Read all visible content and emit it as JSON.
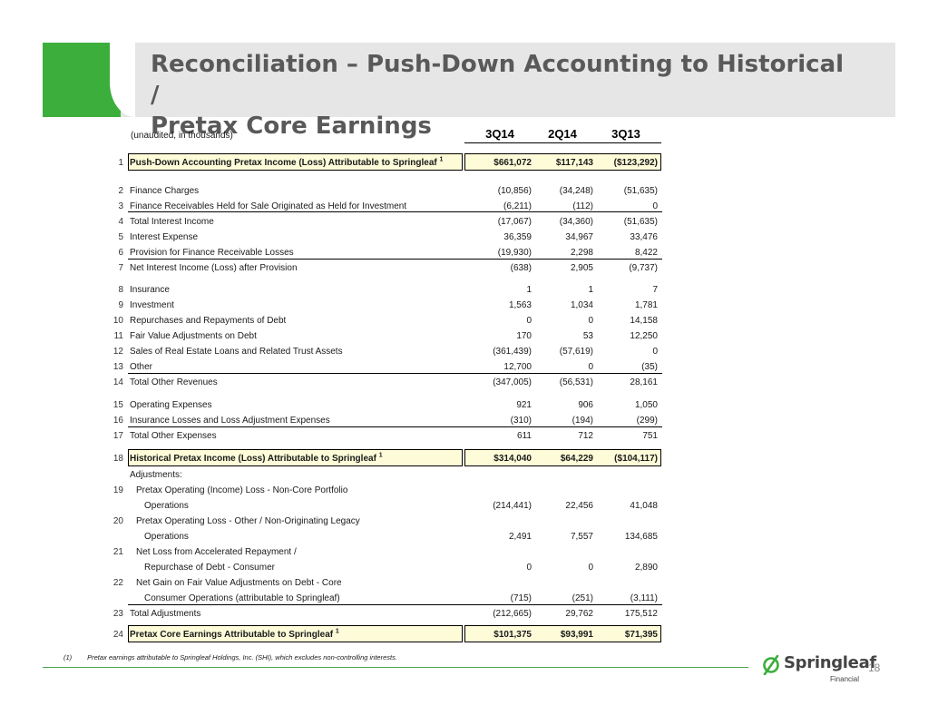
{
  "header": {
    "title_line1": "Reconciliation – Push-Down Accounting to Historical /",
    "title_line2": "Pretax Core Earnings"
  },
  "table": {
    "units": "(unaudited, in thousands)",
    "columns": [
      "3Q14",
      "2Q14",
      "3Q13"
    ],
    "rows": [
      {
        "num": "1",
        "label": "Push-Down Accounting Pretax Income (Loss) Attributable to Springleaf",
        "sup": "1",
        "values": [
          "$661,072",
          "$117,143",
          "($123,292)"
        ]
      },
      {
        "num": "2",
        "label": "Finance Charges",
        "values": [
          "(10,856)",
          "(34,248)",
          "(51,635)"
        ]
      },
      {
        "num": "3",
        "label": "Finance Receivables Held for Sale Originated as Held for Investment",
        "values": [
          "(6,211)",
          "(112)",
          "0"
        ]
      },
      {
        "num": "4",
        "label": "Total Interest Income",
        "values": [
          "(17,067)",
          "(34,360)",
          "(51,635)"
        ]
      },
      {
        "num": "5",
        "label": "Interest Expense",
        "values": [
          "36,359",
          "34,967",
          "33,476"
        ]
      },
      {
        "num": "6",
        "label": "Provision for Finance Receivable Losses",
        "values": [
          "(19,930)",
          "2,298",
          "8,422"
        ]
      },
      {
        "num": "7",
        "label": "Net Interest Income (Loss) after Provision",
        "values": [
          "(638)",
          "2,905",
          "(9,737)"
        ]
      },
      {
        "num": "8",
        "label": "Insurance",
        "values": [
          "1",
          "1",
          "7"
        ]
      },
      {
        "num": "9",
        "label": "Investment",
        "values": [
          "1,563",
          "1,034",
          "1,781"
        ]
      },
      {
        "num": "10",
        "label": "Repurchases and Repayments of Debt",
        "values": [
          "0",
          "0",
          "14,158"
        ]
      },
      {
        "num": "11",
        "label": "Fair Value Adjustments on Debt",
        "values": [
          "170",
          "53",
          "12,250"
        ]
      },
      {
        "num": "12",
        "label": "Sales of Real Estate Loans and Related Trust Assets",
        "values": [
          "(361,439)",
          "(57,619)",
          "0"
        ]
      },
      {
        "num": "13",
        "label": "Other",
        "values": [
          "12,700",
          "0",
          "(35)"
        ]
      },
      {
        "num": "14",
        "label": "Total Other Revenues",
        "values": [
          "(347,005)",
          "(56,531)",
          "28,161"
        ]
      },
      {
        "num": "15",
        "label": "Operating Expenses",
        "values": [
          "921",
          "906",
          "1,050"
        ]
      },
      {
        "num": "16",
        "label": "Insurance Losses and Loss Adjustment Expenses",
        "values": [
          "(310)",
          "(194)",
          "(299)"
        ]
      },
      {
        "num": "17",
        "label": "Total Other Expenses",
        "values": [
          "611",
          "712",
          "751"
        ]
      },
      {
        "num": "18",
        "label": "Historical Pretax Income (Loss) Attributable to Springleaf",
        "sup": "1",
        "values": [
          "$314,040",
          "$64,229",
          "($104,117)"
        ]
      },
      {
        "label": "Adjustments:"
      },
      {
        "num": "19",
        "label": "Pretax Operating (Income) Loss - Non-Core Portfolio",
        "label2": "Operations",
        "values": [
          "(214,441)",
          "22,456",
          "41,048"
        ]
      },
      {
        "num": "20",
        "label": "Pretax Operating Loss - Other / Non-Originating Legacy",
        "label2": "Operations",
        "values": [
          "2,491",
          "7,557",
          "134,685"
        ]
      },
      {
        "num": "21",
        "label": "Net Loss from Accelerated Repayment /",
        "label2": "Repurchase of Debt - Consumer",
        "values": [
          "0",
          "0",
          "2,890"
        ]
      },
      {
        "num": "22",
        "label": "Net Gain on Fair Value Adjustments on Debt - Core",
        "label2": "Consumer Operations (attributable to Springleaf)",
        "values": [
          "(715)",
          "(251)",
          "(3,111)"
        ]
      },
      {
        "num": "23",
        "label": "Total Adjustments",
        "values": [
          "(212,665)",
          "29,762",
          "175,512"
        ]
      },
      {
        "num": "24",
        "label": "Pretax Core Earnings Attributable to Springleaf",
        "sup": "1",
        "values": [
          "$101,375",
          "$93,991",
          "$71,395"
        ]
      }
    ]
  },
  "footer": {
    "footnote_marker": "(1)",
    "footnote_text": "Pretax earnings attributable to Springleaf Holdings, Inc. (SHI), which excludes non-controlling interests.",
    "logo_word": "Springleaf",
    "logo_sub": "Financial",
    "page_number": "18"
  },
  "colors": {
    "accent_green": "#3cae3c",
    "header_gray": "#e6e6e6",
    "title_gray": "#595959",
    "highlight_yellow": "#fdfbd8"
  }
}
